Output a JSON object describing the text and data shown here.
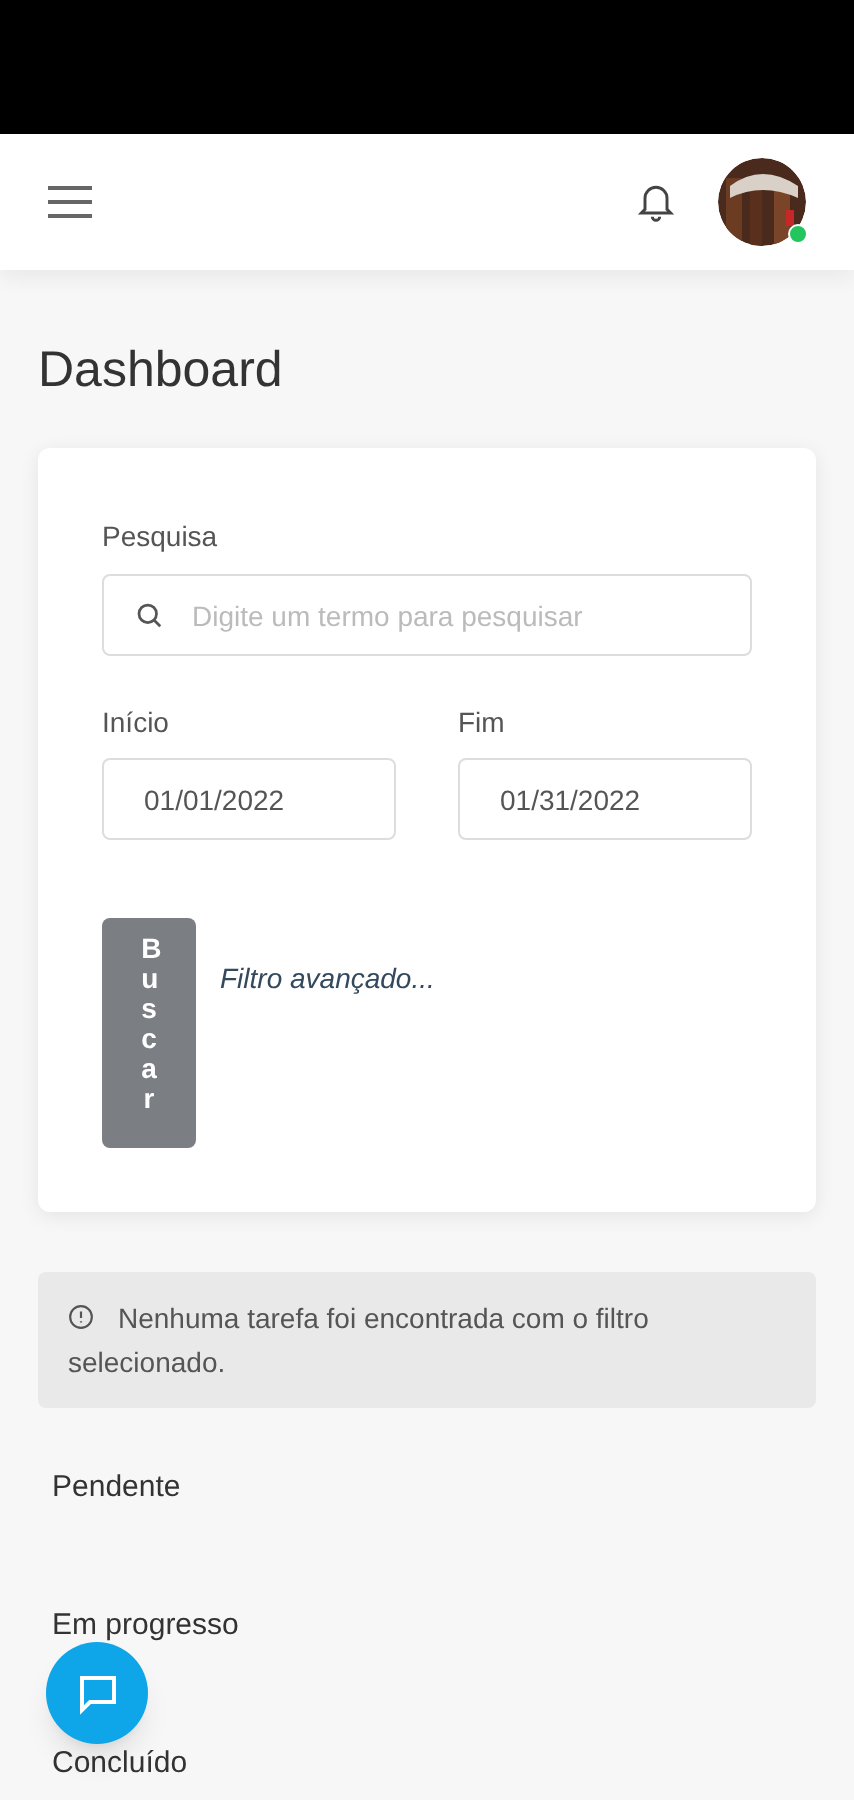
{
  "header": {
    "avatar": {
      "kind": "picture",
      "online": true
    }
  },
  "title": "Dashboard",
  "filter": {
    "search_label": "Pesquisa",
    "search_placeholder": "Digite um termo para pesquisar",
    "start_label": "Início",
    "start_value": "01/01/2022",
    "end_label": "Fim",
    "end_value": "01/31/2022",
    "search_button": "Buscar",
    "advanced_link": "Filtro avançado..."
  },
  "alert": "Nenhuma tarefa foi encontrada com o filtro selecionado.",
  "sections": [
    "Pendente",
    "Em progresso",
    "Concluído"
  ]
}
